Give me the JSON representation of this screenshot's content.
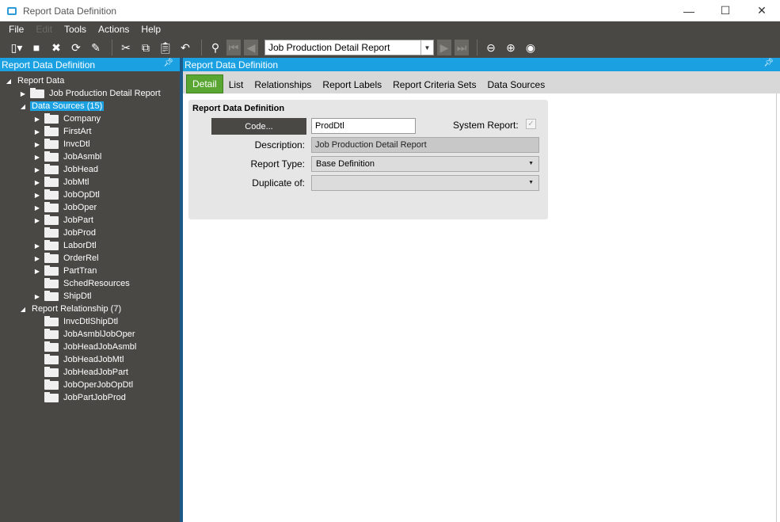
{
  "window": {
    "title": "Report Data Definition",
    "minimize": "—",
    "maximize": "☐",
    "close": "✕"
  },
  "menu": [
    "File",
    "Edit",
    "Tools",
    "Actions",
    "Help"
  ],
  "toolbar": {
    "report_combo_value": "Job Production Detail Report"
  },
  "left_panel": {
    "header": "Report Data Definition",
    "tree": {
      "root": "Report Data",
      "report": "Job Production Detail Report",
      "data_sources_label": "Data Sources (15)",
      "data_sources": [
        "Company",
        "FirstArt",
        "InvcDtl",
        "JobAsmbl",
        "JobHead",
        "JobMtl",
        "JobOpDtl",
        "JobOper",
        "JobPart",
        "JobProd",
        "LaborDtl",
        "OrderRel",
        "PartTran",
        "SchedResources",
        "ShipDtl"
      ],
      "relationships_label": "Report Relationship (7)",
      "relationships": [
        "InvcDtlShipDtl",
        "JobAsmblJobOper",
        "JobHeadJobAsmbl",
        "JobHeadJobMtl",
        "JobHeadJobPart",
        "JobOperJobOpDtl",
        "JobPartJobProd"
      ]
    }
  },
  "right_panel": {
    "header": "Report Data Definition",
    "tabs": [
      "Detail",
      "List",
      "Relationships",
      "Report Labels",
      "Report Criteria Sets",
      "Data Sources"
    ],
    "form": {
      "group_title": "Report Data Definition",
      "code_button": "Code...",
      "code_value": "ProdDtl",
      "system_report_label": "System Report:",
      "system_report_checked": true,
      "description_label": "Description:",
      "description_value": "Job Production Detail Report",
      "report_type_label": "Report Type:",
      "report_type_value": "Base Definition",
      "duplicate_of_label": "Duplicate of:",
      "duplicate_of_value": ""
    }
  }
}
